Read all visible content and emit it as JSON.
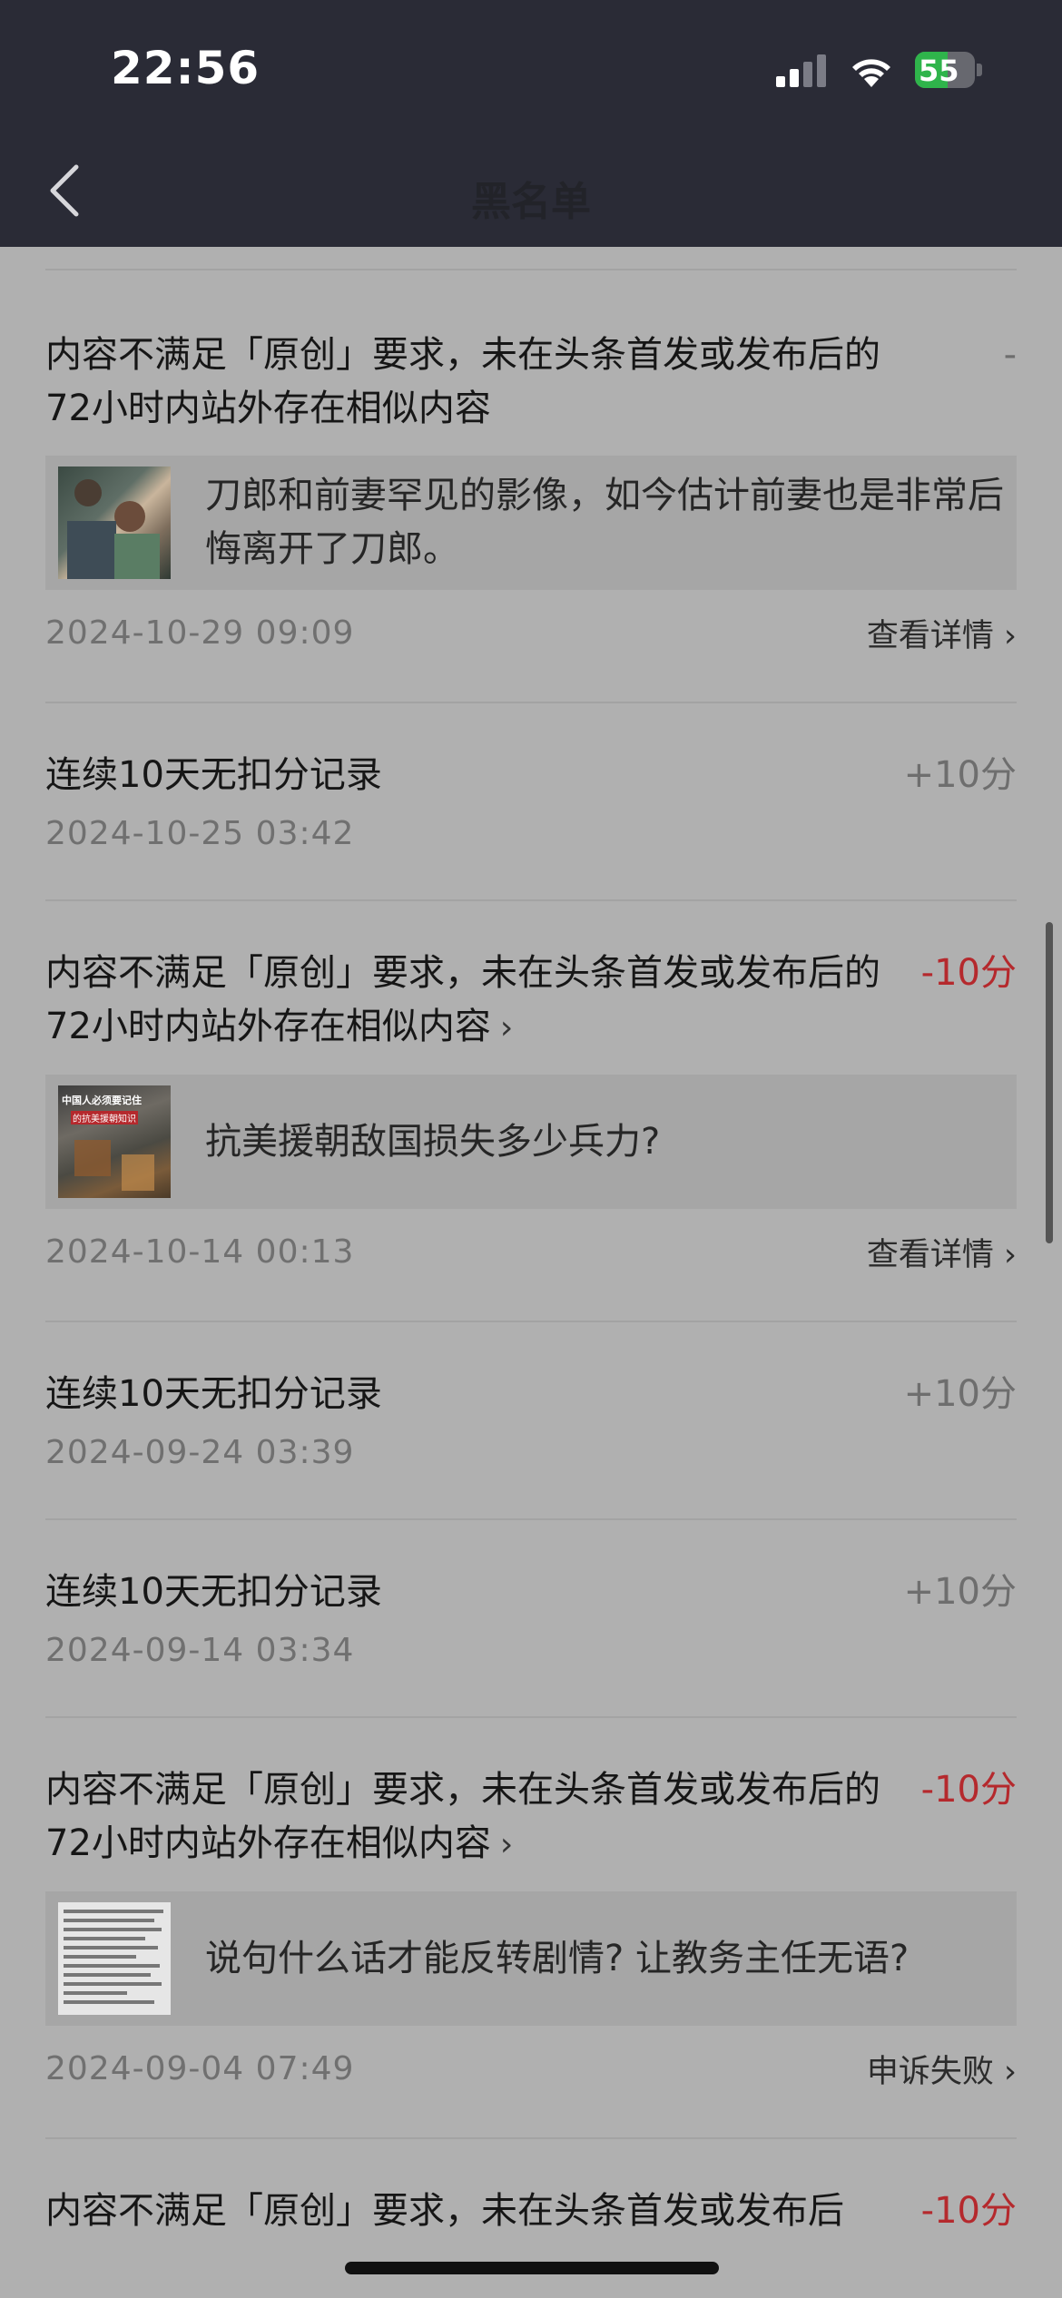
{
  "status": {
    "time": "22:56",
    "battery": "55",
    "battery_level": 0.55
  },
  "nav": {
    "title": "黑名单",
    "back_icon": "chevron-left-icon"
  },
  "records": [
    {
      "desc": "内容不满足「原创」要求，未在头条首发或发布后的72小时内站外存在相似内容",
      "score": "-",
      "article": "刀郎和前妻罕见的影像，如今估计前妻也是非常后悔离开了刀郎。",
      "date": "2024-10-29 09:09",
      "action": "查看详情"
    },
    {
      "desc": "连续10天无扣分记录",
      "score": "+10分",
      "date": "2024-10-25 03:42"
    },
    {
      "desc": "内容不满足「原创」要求，未在头条首发或发布后的72小时内站外存在相似内容",
      "score": "-10分",
      "article": "抗美援朝敌国损失多少兵力?",
      "thumb_text_1": "中国人必须要记住",
      "thumb_text_2": "的抗美援朝知识",
      "date": "2024-10-14 00:13",
      "action": "查看详情"
    },
    {
      "desc": "连续10天无扣分记录",
      "score": "+10分",
      "date": "2024-09-24 03:39"
    },
    {
      "desc": "连续10天无扣分记录",
      "score": "+10分",
      "date": "2024-09-14 03:34"
    },
    {
      "desc": "内容不满足「原创」要求，未在头条首发或发布后的72小时内站外存在相似内容",
      "score": "-10分",
      "article": "说句什么话才能反转剧情? 让教务主任无语?",
      "date": "2024-09-04 07:49",
      "action": "申诉失败"
    },
    {
      "desc": "内容不满足「原创」要求，未在头条首发或发布后",
      "score": "-10分"
    }
  ],
  "colors": {
    "negative": "#b5292d",
    "positive": "#6e6e6e",
    "header": "#2a2b36",
    "background": "#b0b0b0"
  }
}
